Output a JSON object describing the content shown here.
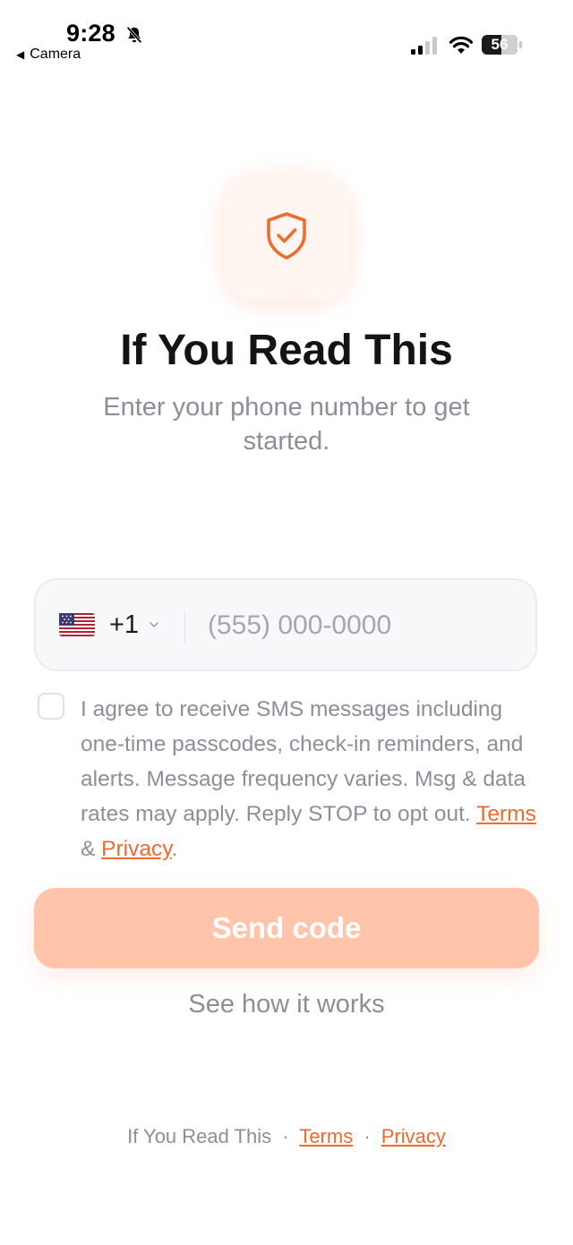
{
  "status_bar": {
    "time": "9:28",
    "back_label": "Camera",
    "battery": "56",
    "icons": [
      "bell-slash-icon",
      "signal-icon",
      "wifi-icon",
      "battery-icon"
    ]
  },
  "logo": {
    "icon": "shield-check-icon",
    "accent": "#f26b2e"
  },
  "header": {
    "title": "If You Read This",
    "subtitle": "Enter your phone number to get started."
  },
  "phone": {
    "flag": "us-flag-icon",
    "country_code": "+1",
    "placeholder": "(555) 000-0000",
    "value": ""
  },
  "consent": {
    "checked": false,
    "text": "I agree to receive SMS messages including one-time passcodes, check-in reminders, and alerts. Message frequency varies. Msg & data rates may apply. Reply STOP to opt out.",
    "terms_label": "Terms",
    "amp": "&",
    "privacy_label": "Privacy",
    "end": "."
  },
  "actions": {
    "send_label": "Send code",
    "how_label": "See how it works"
  },
  "footer": {
    "brand": "If You Read This",
    "separator": "·",
    "terms_label": "Terms",
    "privacy_label": "Privacy"
  },
  "colors": {
    "accent": "#ef6a30",
    "button_disabled": "#ffc4a9",
    "muted_text": "#8a8f99"
  }
}
